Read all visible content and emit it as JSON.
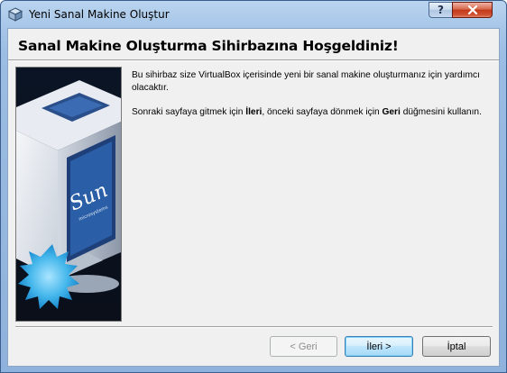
{
  "window": {
    "title": "Yeni Sanal Makine Oluştur",
    "help_label": "?",
    "close_label": "✕"
  },
  "wizard": {
    "heading": "Sanal Makine Oluşturma Sihirbazına Hoşgeldiniz!",
    "paragraph1": "Bu sihirbaz size VirtualBox içerisinde yeni bir sanal makine oluşturmanız için yardımcı olacaktır.",
    "paragraph2_before_next": "Sonraki sayfaya gitmek için ",
    "next_word": "İleri",
    "paragraph2_middle": ", önceki sayfaya dönmek için ",
    "back_word": "Geri",
    "paragraph2_after": " düğmesini kullanın.",
    "image_label": "Sun",
    "image_sublabel": "microsystems"
  },
  "buttons": {
    "back_label": "< Geri",
    "next_label": "İleri >",
    "cancel_label": "İptal"
  },
  "colors": {
    "title_bar": "#a7c6e8",
    "client_bg": "#f0f0f0",
    "image_bg": "#000000",
    "monitor_blue": "#2a5fa8",
    "starburst": "#3fb0e6",
    "close_button": "#c2391a"
  }
}
